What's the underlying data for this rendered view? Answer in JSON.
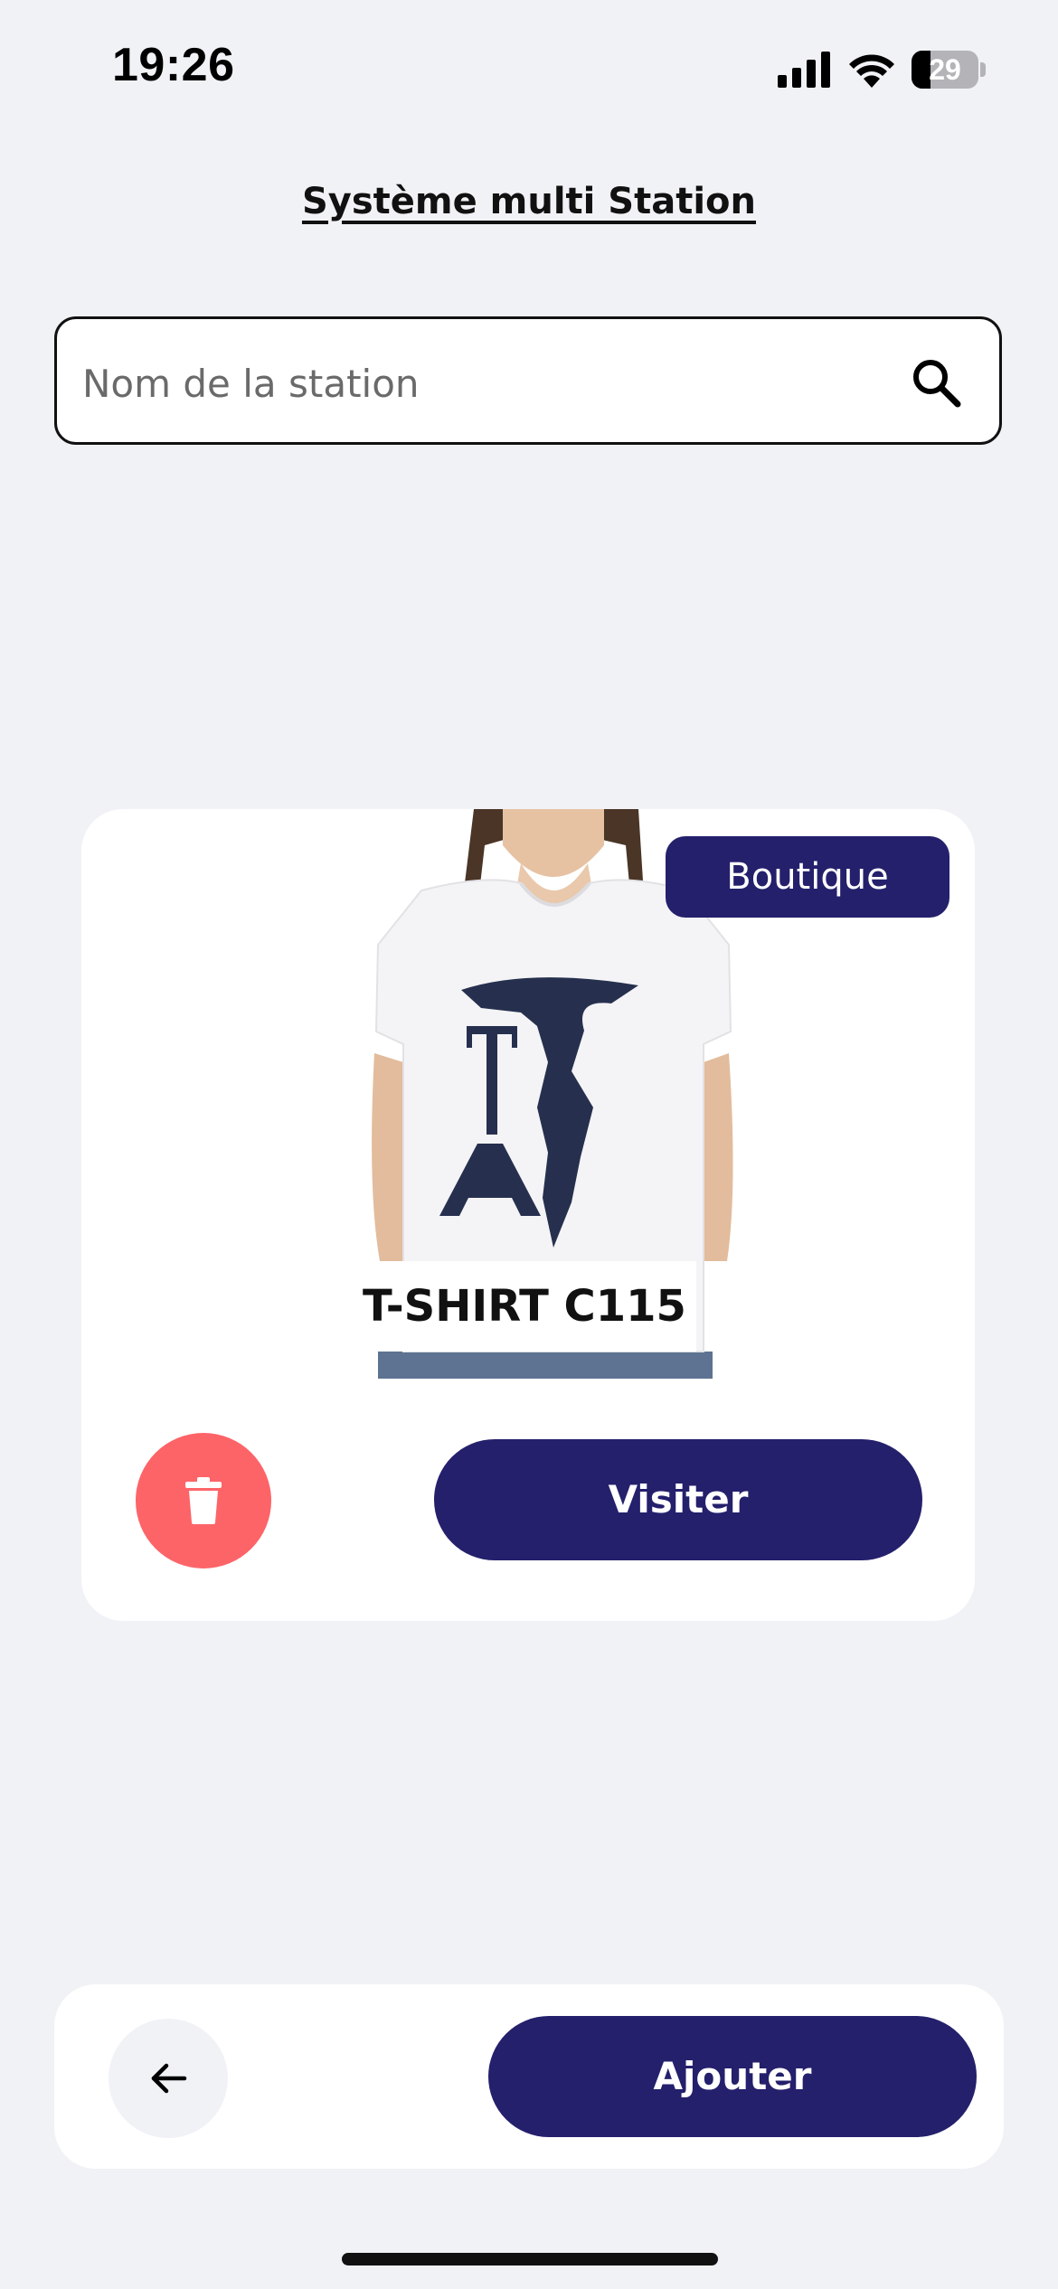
{
  "status_bar": {
    "time": "19:26",
    "battery_level": "29",
    "battery_fraction": 0.29,
    "icons": [
      "signal-icon",
      "wifi-icon",
      "battery-icon"
    ]
  },
  "header": {
    "title": "Système multi Station"
  },
  "search": {
    "placeholder": "Nom de la station",
    "value": "",
    "icon": "search-icon"
  },
  "stations": [
    {
      "name": "T-SHIRT C115",
      "category": "Boutique",
      "visit_label": "Visiter",
      "delete_icon": "trash-icon",
      "image_print_letters": "TA"
    }
  ],
  "footer": {
    "back_icon": "arrow-left-icon",
    "add_label": "Ajouter"
  },
  "colors": {
    "primary": "#24206c",
    "danger": "#fd6468",
    "background": "#f1f2f6",
    "card": "#ffffff"
  }
}
